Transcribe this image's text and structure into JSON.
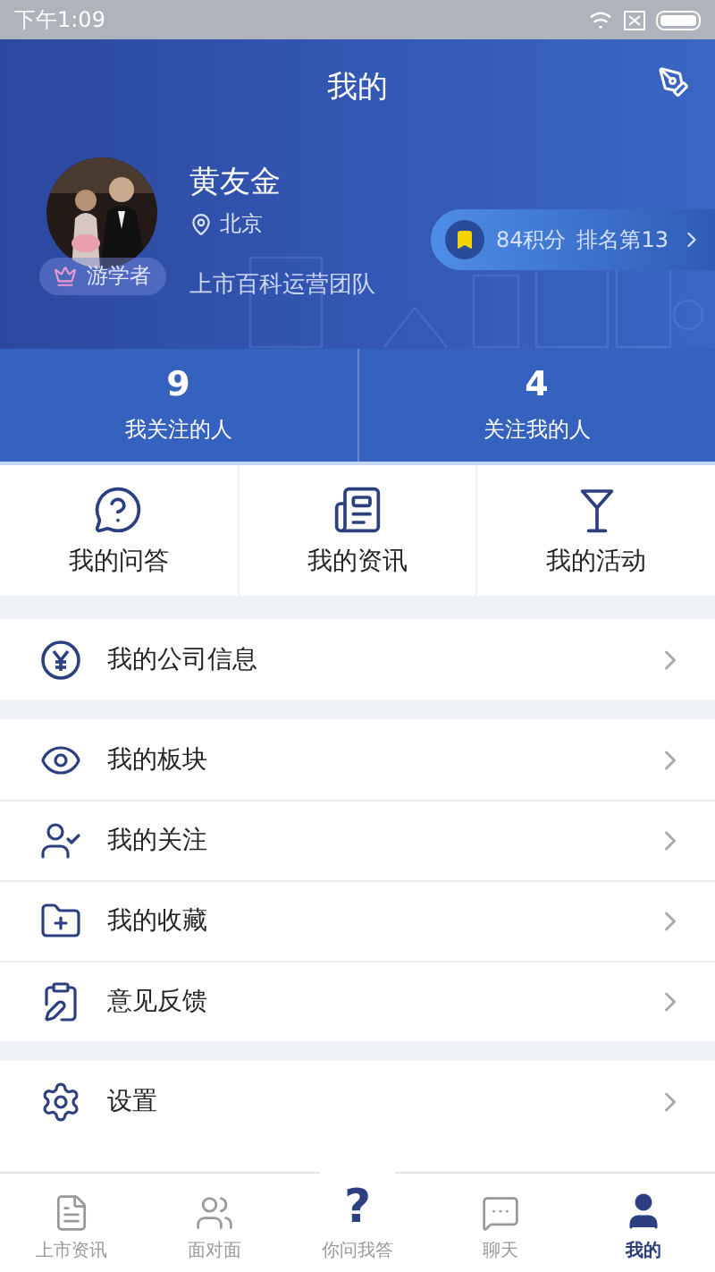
{
  "status_bar": {
    "time": "下午1:09"
  },
  "header": {
    "title": "我的"
  },
  "profile": {
    "name": "黄友金",
    "location": "北京",
    "badge": "游学者",
    "team": "上市百科运营团队",
    "points": "84积分",
    "rank": "排名第13"
  },
  "stats": [
    {
      "value": "9",
      "label": "我关注的人"
    },
    {
      "value": "4",
      "label": "关注我的人"
    }
  ],
  "shortcuts": [
    "我的问答",
    "我的资讯",
    "我的活动"
  ],
  "sections": [
    [
      "我的公司信息"
    ],
    [
      "我的板块",
      "我的关注",
      "我的收藏",
      "意见反馈"
    ],
    [
      "设置"
    ]
  ],
  "tab_bar": [
    {
      "label": "上市资讯",
      "selected": false
    },
    {
      "label": "面对面",
      "selected": false
    },
    {
      "label": "你问我答",
      "selected": false,
      "kind": "center",
      "glyph": "?"
    },
    {
      "label": "聊天",
      "selected": false
    },
    {
      "label": "我的",
      "selected": true
    }
  ]
}
